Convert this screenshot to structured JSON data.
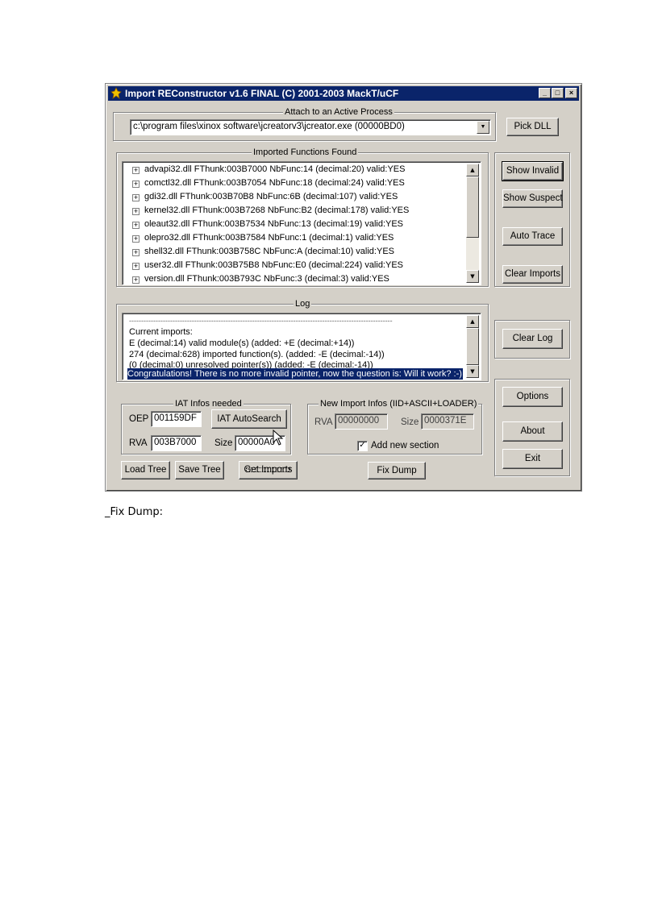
{
  "window": {
    "title": "Import REConstructor v1.6 FINAL (C) 2001-2003 MackT/uCF",
    "minimize_glyph": "_",
    "maximize_glyph": "□",
    "close_glyph": "×"
  },
  "attach": {
    "legend": "Attach to an Active Process",
    "process_value": "c:\\program files\\xinox software\\jcreatorv3\\jcreator.exe (00000BD0)",
    "pick_dll_label": "Pick DLL"
  },
  "imports": {
    "legend": "Imported Functions Found",
    "expand_glyph": "+",
    "items": [
      "advapi32.dll FThunk:003B7000 NbFunc:14 (decimal:20) valid:YES",
      "comctl32.dll FThunk:003B7054 NbFunc:18 (decimal:24) valid:YES",
      "gdi32.dll FThunk:003B70B8 NbFunc:6B (decimal:107) valid:YES",
      "kernel32.dll FThunk:003B7268 NbFunc:B2 (decimal:178) valid:YES",
      "oleaut32.dll FThunk:003B7534 NbFunc:13 (decimal:19) valid:YES",
      "olepro32.dll FThunk:003B7584 NbFunc:1 (decimal:1) valid:YES",
      "shell32.dll FThunk:003B758C NbFunc:A (decimal:10) valid:YES",
      "user32.dll FThunk:003B75B8 NbFunc:E0 (decimal:224) valid:YES",
      "version.dll FThunk:003B793C NbFunc:3 (decimal:3) valid:YES"
    ]
  },
  "side_buttons": {
    "show_invalid": "Show Invalid",
    "show_suspect": "Show Suspect",
    "auto_trace": "Auto Trace",
    "clear_imports": "Clear Imports",
    "clear_log": "Clear Log",
    "options": "Options",
    "about": "About",
    "exit": "Exit"
  },
  "log": {
    "legend": "Log",
    "separator": "-------------------------------------------------------------------------------------------------------------",
    "lines": [
      "Current imports:",
      "E (decimal:14) valid module(s) (added: +E (decimal:+14))",
      "274 (decimal:628) imported function(s). (added: -E (decimal:-14))",
      "(0 (decimal:0) unresolved pointer(s)) (added: -E (decimal:-14))"
    ],
    "selected_line": "Congratulations! There is no more invalid pointer, now the question is: Will it work? :-)"
  },
  "iat": {
    "legend": "IAT Infos needed",
    "oep_label": "OEP",
    "oep_value": "001159DF",
    "autosearch_label": "IAT AutoSearch",
    "rva_label": "RVA",
    "rva_value": "003B7000",
    "size_label": "Size",
    "size_value": "00000A0"
  },
  "new_import": {
    "legend": "New Import Infos (IID+ASCII+LOADER)",
    "rva_label": "RVA",
    "rva_value": "00000000",
    "size_label": "Size",
    "size_value": "0000371E",
    "add_section_label": "Add new section",
    "add_section_checked": true,
    "check_glyph": "✓"
  },
  "bottom_buttons": {
    "load_tree": "Load Tree",
    "save_tree": "Save Tree",
    "get_imports": "Get Imports",
    "fix_dump": "Fix Dump"
  },
  "caption": "_Fix Dump:"
}
